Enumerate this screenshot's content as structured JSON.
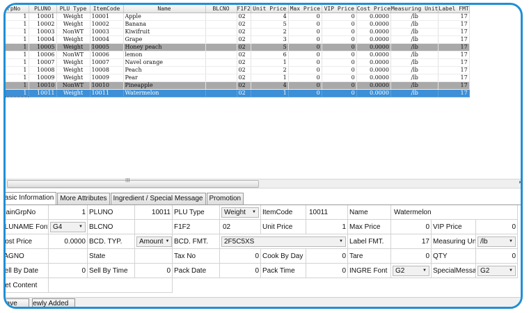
{
  "grid": {
    "columns": [
      "GrpNo",
      "PLUNO",
      "PLU Type",
      "ItemCode",
      "Name",
      "BLCNO",
      "F1F2",
      "Unit Price",
      "Max Price",
      "VIP Price",
      "Cost Price",
      "Measuring Unit",
      "Label FMT"
    ],
    "rows": [
      {
        "grp": "1",
        "pluno": "10001",
        "type": "Weight",
        "code": "10001",
        "name": "Apple",
        "blcno": "",
        "f1f2": "02",
        "unit": "4",
        "max": "0",
        "vip": "0",
        "cost": "0.0000",
        "mu": "/lb",
        "lfmt": "17",
        "state": "normal"
      },
      {
        "grp": "1",
        "pluno": "10002",
        "type": "Weight",
        "code": "10002",
        "name": "Banana",
        "blcno": "",
        "f1f2": "02",
        "unit": "5",
        "max": "0",
        "vip": "0",
        "cost": "0.0000",
        "mu": "/lb",
        "lfmt": "17",
        "state": "normal"
      },
      {
        "grp": "1",
        "pluno": "10003",
        "type": "NonWT",
        "code": "10003",
        "name": "Kiwifruit",
        "blcno": "",
        "f1f2": "02",
        "unit": "2",
        "max": "0",
        "vip": "0",
        "cost": "0.0000",
        "mu": "/lb",
        "lfmt": "17",
        "state": "normal"
      },
      {
        "grp": "1",
        "pluno": "10004",
        "type": "Weight",
        "code": "10004",
        "name": "Grape",
        "blcno": "",
        "f1f2": "02",
        "unit": "3",
        "max": "0",
        "vip": "0",
        "cost": "0.0000",
        "mu": "/lb",
        "lfmt": "17",
        "state": "normal"
      },
      {
        "grp": "1",
        "pluno": "10005",
        "type": "Weight",
        "code": "10005",
        "name": "Honey peach",
        "blcno": "",
        "f1f2": "02",
        "unit": "5",
        "max": "0",
        "vip": "0",
        "cost": "0.0000",
        "mu": "/lb",
        "lfmt": "17",
        "state": "gray"
      },
      {
        "grp": "1",
        "pluno": "10006",
        "type": "NonWT",
        "code": "10006",
        "name": "lemon",
        "blcno": "",
        "f1f2": "02",
        "unit": "6",
        "max": "0",
        "vip": "0",
        "cost": "0.0000",
        "mu": "/lb",
        "lfmt": "17",
        "state": "normal"
      },
      {
        "grp": "1",
        "pluno": "10007",
        "type": "Weight",
        "code": "10007",
        "name": "Navel orange",
        "blcno": "",
        "f1f2": "02",
        "unit": "1",
        "max": "0",
        "vip": "0",
        "cost": "0.0000",
        "mu": "/lb",
        "lfmt": "17",
        "state": "normal"
      },
      {
        "grp": "1",
        "pluno": "10008",
        "type": "Weight",
        "code": "10008",
        "name": "Peach",
        "blcno": "",
        "f1f2": "02",
        "unit": "2",
        "max": "0",
        "vip": "0",
        "cost": "0.0000",
        "mu": "/lb",
        "lfmt": "17",
        "state": "normal"
      },
      {
        "grp": "1",
        "pluno": "10009",
        "type": "Weight",
        "code": "10009",
        "name": "Pear",
        "blcno": "",
        "f1f2": "02",
        "unit": "1",
        "max": "0",
        "vip": "0",
        "cost": "0.0000",
        "mu": "/lb",
        "lfmt": "17",
        "state": "normal"
      },
      {
        "grp": "1",
        "pluno": "10010",
        "type": "NonWT",
        "code": "10010",
        "name": "Pineapple",
        "blcno": "",
        "f1f2": "02",
        "unit": "4",
        "max": "0",
        "vip": "0",
        "cost": "0.0000",
        "mu": "/lb",
        "lfmt": "17",
        "state": "gray"
      },
      {
        "grp": "1",
        "pluno": "10011",
        "type": "Weight",
        "code": "10011",
        "name": "Watermelon",
        "blcno": "",
        "f1f2": "02",
        "unit": "1",
        "max": "0",
        "vip": "0",
        "cost": "0.0000",
        "mu": "/lb",
        "lfmt": "17",
        "state": "selected"
      }
    ],
    "scroll_grip": "III",
    "scroll_arrow": "▸"
  },
  "tabs": [
    "Basic Information",
    "More Attributes",
    "Ingredient / Special Message",
    "Promotion"
  ],
  "form": {
    "r1": {
      "l1": "MainGrpNo",
      "v1": "1",
      "l2": "PLUNO",
      "v2": "10011",
      "l3": "PLU Type",
      "v3": "Weight",
      "l4": "ItemCode",
      "v4": "10011",
      "l5": "Name",
      "v5": "Watermelon"
    },
    "r2": {
      "l1": "PLUNAME Font",
      "v1": "G4",
      "l2": "BLCNO",
      "v2": "",
      "l3": "F1F2",
      "v3": "02",
      "l4": "Unit Price",
      "v4": "1",
      "l5": "Max Price",
      "v5": "0",
      "l6": "VIP Price",
      "v6": "0"
    },
    "r3": {
      "l1": "Cost Price",
      "v1": "0.0000",
      "l2": "BCD. TYP.",
      "v2": "Amount",
      "l3": "BCD. FMT.",
      "v3": "2F5C5XS",
      "l5": "Label FMT.",
      "v5": "17",
      "l6": "Measuring Unit",
      "v6": "/lb"
    },
    "r4": {
      "l1": "TAGNO",
      "v1": "",
      "l2": "State",
      "v2": "",
      "l3": "Tax No",
      "v3": "0",
      "l4": "Cook By Day",
      "v4": "0",
      "l5": "Tare",
      "v5": "0",
      "l6": "QTY",
      "v6": "0"
    },
    "r5": {
      "l1": "Sell By Date",
      "v1": "0",
      "l2": "Sell By Time",
      "v2": "0",
      "l3": "Pack Date",
      "v3": "0",
      "l4": "Pack Time",
      "v4": "0",
      "l5": "INGRE Font",
      "v5": "G2",
      "l6": "SpecialMessage",
      "v6": "G2"
    },
    "r6": {
      "l1": "Net Content",
      "v1": ""
    }
  },
  "buttons": {
    "save": "Save",
    "newly_added": "Newly Added"
  },
  "colors": {
    "frame": "#1f8fd4",
    "selected_row": "#3d8fd6",
    "gray_row": "#a9a9a9"
  }
}
